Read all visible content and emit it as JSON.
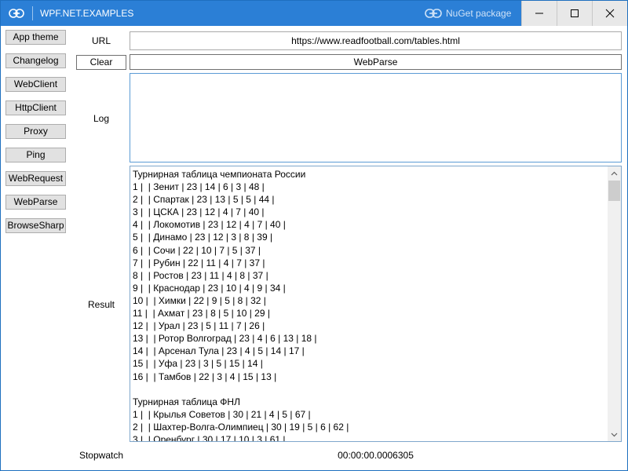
{
  "window": {
    "title": "WPF.NET.EXAMPLES",
    "nuget_label": "NuGet package"
  },
  "sidebar": {
    "items": [
      {
        "label": "App theme"
      },
      {
        "label": "Changelog"
      },
      {
        "label": "WebClient"
      },
      {
        "label": "HttpClient"
      },
      {
        "label": "Proxy"
      },
      {
        "label": "Ping"
      },
      {
        "label": "WebRequest"
      },
      {
        "label": "WebParse"
      },
      {
        "label": "BrowseSharp"
      }
    ]
  },
  "form": {
    "url_label": "URL",
    "url_value": "https://www.readfootball.com/tables.html",
    "clear_label": "Clear",
    "webparse_value": "WebParse",
    "log_label": "Log",
    "log_value": "",
    "result_label": "Result",
    "result_lines": [
      "Турнирная таблица чемпионата России",
      "1 |  | Зенит | 23 | 14 | 6 | 3 | 48 |",
      "2 |  | Спартак | 23 | 13 | 5 | 5 | 44 |",
      "3 |  | ЦСКА | 23 | 12 | 4 | 7 | 40 |",
      "4 |  | Локомотив | 23 | 12 | 4 | 7 | 40 |",
      "5 |  | Динамо | 23 | 12 | 3 | 8 | 39 |",
      "6 |  | Сочи | 22 | 10 | 7 | 5 | 37 |",
      "7 |  | Рубин | 22 | 11 | 4 | 7 | 37 |",
      "8 |  | Ростов | 23 | 11 | 4 | 8 | 37 |",
      "9 |  | Краснодар | 23 | 10 | 4 | 9 | 34 |",
      "10 |  | Химки | 22 | 9 | 5 | 8 | 32 |",
      "11 |  | Ахмат | 23 | 8 | 5 | 10 | 29 |",
      "12 |  | Урал | 23 | 5 | 11 | 7 | 26 |",
      "13 |  | Ротор Волгоград | 23 | 4 | 6 | 13 | 18 |",
      "14 |  | Арсенал Тула | 23 | 4 | 5 | 14 | 17 |",
      "15 |  | Уфа | 23 | 3 | 5 | 15 | 14 |",
      "16 |  | Тамбов | 22 | 3 | 4 | 15 | 13 |",
      "",
      "Турнирная таблица ФНЛ",
      "1 |  | Крылья Советов | 30 | 21 | 4 | 5 | 67 |",
      "2 |  | Шахтер-Волга-Олимпиец | 30 | 19 | 5 | 6 | 62 |",
      "3 |  | Оренбург | 30 | 17 | 10 | 3 | 61 |"
    ],
    "stopwatch_label": "Stopwatch",
    "stopwatch_value": "00:00:00.0006305"
  },
  "colors": {
    "titlebar": "#2b7fd6",
    "accent_border": "#5b9bd5"
  },
  "icons": {
    "title_icon": "link-icon",
    "nuget_icon": "link-icon",
    "minimize": "minimize-icon",
    "maximize": "maximize-icon",
    "close": "close-icon"
  }
}
